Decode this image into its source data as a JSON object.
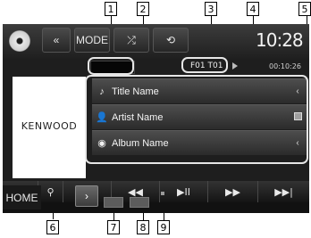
{
  "topbar": {
    "mode_label": "MODE",
    "prev_label": "«",
    "shuffle_label": "⤮",
    "repeat_label": "⟲",
    "clock": "10:28"
  },
  "status": {
    "folder_track": "F01  T01",
    "play_time": "00:10:26"
  },
  "artwork": {
    "brand": "KENWOOD"
  },
  "info": {
    "title": "Title Name",
    "artist": "Artist Name",
    "album": "Album Name"
  },
  "controls": {
    "source_icon": "⇄",
    "search_icon": "🔍",
    "prev_track": "|◀◀",
    "rewind": "◀◀",
    "play_pause": "▶II",
    "forward": "▶▶",
    "next_track": "▶▶|"
  },
  "bottom": {
    "home_label": "HOME",
    "arrow_label": "›"
  },
  "callouts": [
    "1",
    "2",
    "3",
    "4",
    "5",
    "6",
    "7",
    "8",
    "9"
  ]
}
